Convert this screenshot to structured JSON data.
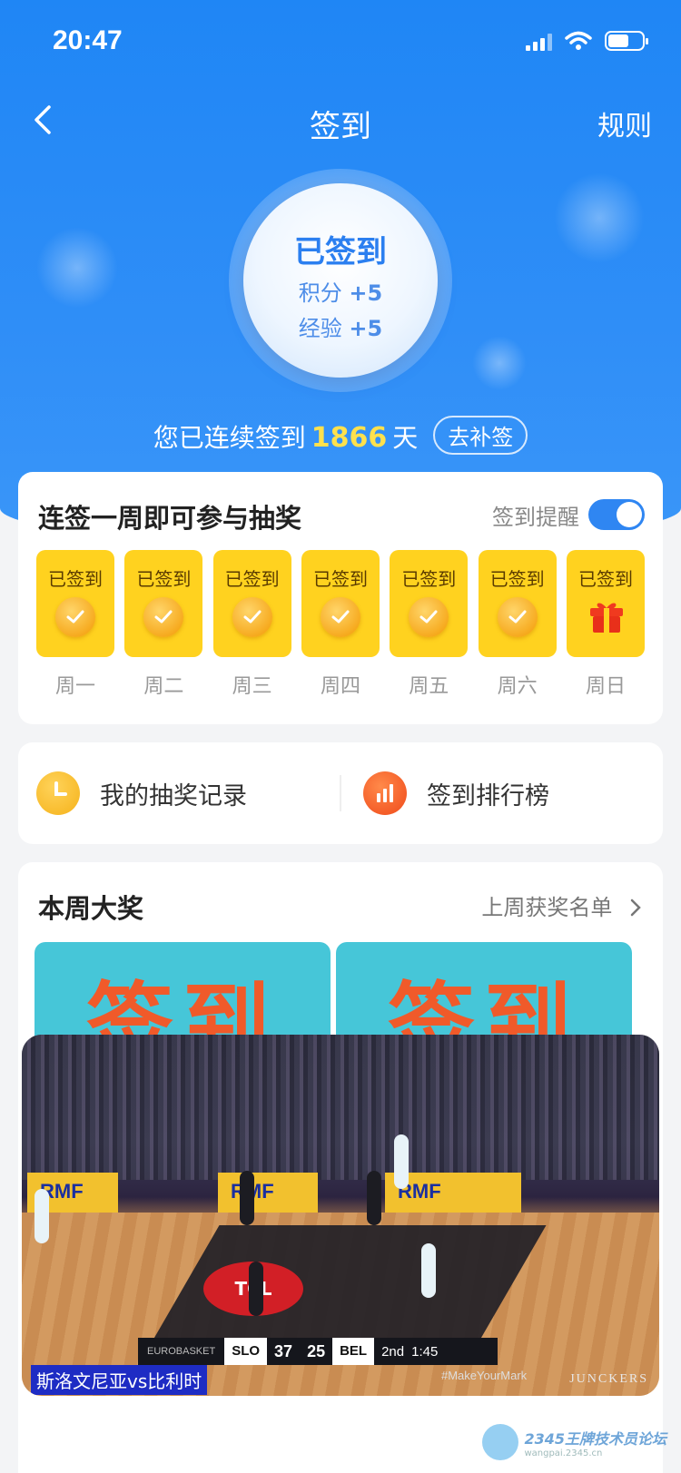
{
  "status_bar": {
    "time": "20:47"
  },
  "nav": {
    "title": "签到",
    "rules": "规则"
  },
  "badge": {
    "title": "已签到",
    "lines": [
      {
        "label": "积分",
        "value": "+5"
      },
      {
        "label": "经验",
        "value": "+5"
      }
    ]
  },
  "streak": {
    "prefix": "您已连续签到",
    "days": "1866",
    "suffix": "天",
    "makeup_button": "去补签"
  },
  "week": {
    "title": "连签一周即可参与抽奖",
    "reminder_label": "签到提醒",
    "reminder_on": true,
    "days": [
      {
        "status": "已签到",
        "name": "周一",
        "icon": "check-icon"
      },
      {
        "status": "已签到",
        "name": "周二",
        "icon": "check-icon"
      },
      {
        "status": "已签到",
        "name": "周三",
        "icon": "check-icon"
      },
      {
        "status": "已签到",
        "name": "周四",
        "icon": "check-icon"
      },
      {
        "status": "已签到",
        "name": "周五",
        "icon": "check-icon"
      },
      {
        "status": "已签到",
        "name": "周六",
        "icon": "check-icon"
      },
      {
        "status": "已签到",
        "name": "周日",
        "icon": "gift-icon"
      }
    ]
  },
  "links": {
    "lottery_record": "我的抽奖记录",
    "leaderboard": "签到排行榜"
  },
  "prize": {
    "title": "本周大奖",
    "last_week_winners": "上周获奖名单",
    "images": [
      {
        "text": "签到"
      },
      {
        "text": "签到"
      }
    ]
  },
  "video": {
    "ad_text": "RMF",
    "court_logo": "TCL",
    "score": {
      "league": "EUROBASKET",
      "home": "SLO",
      "home_score": "37",
      "away_score": "25",
      "away": "BEL",
      "period": "2nd",
      "clock": "1:45"
    },
    "caption": "斯洛文尼亚vs比利时",
    "hashtag": "#MakeYourMark",
    "sponsor": "JUNCKERS"
  },
  "watermark": {
    "text": "2345王牌技术员论坛",
    "sub": "wangpai.2345.cn"
  },
  "colors": {
    "primary": "#1f86f5",
    "day_box": "#ffd21f",
    "streak_number": "#ffe14d"
  }
}
